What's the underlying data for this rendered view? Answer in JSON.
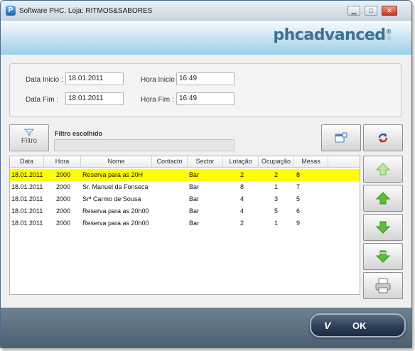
{
  "window": {
    "title": "Software PHC. Loja: RITMOS&SABORES",
    "icon": "phc-app-icon",
    "controls": {
      "minimize": "▁",
      "maximize": "□",
      "close": "✕"
    }
  },
  "header": {
    "logo": "phcadvanced",
    "logo_mark": "®"
  },
  "dates": {
    "data_inicio_label": "Data Inicio :",
    "data_inicio_value": "18.01.2011",
    "hora_inicio_label": "Hora Inicio :",
    "hora_inicio_value": "16:49",
    "data_fim_label": "Data Fim :",
    "data_fim_value": "18.01.2011",
    "hora_fim_label": "Hora Fim :",
    "hora_fim_value": "16:49"
  },
  "filter": {
    "button_label": "Filtro",
    "chosen_label": "Filtro escolhido",
    "chosen_value": ""
  },
  "grid": {
    "columns": [
      "Data",
      "Hora",
      "Nome",
      "Contacto",
      "Sector",
      "Lotação",
      "Ocupação",
      "Mesas"
    ],
    "rows": [
      {
        "data": "18.01.2011",
        "hora": "2000",
        "nome": "Reserva para as 20H",
        "contacto": "",
        "sector": "Bar",
        "lotacao": "2",
        "ocupacao": "2",
        "mesas": "8",
        "selected": true
      },
      {
        "data": "18.01.2011",
        "hora": "2000",
        "nome": "Sr. Manuel da Fonseca",
        "contacto": "",
        "sector": "Bar",
        "lotacao": "8",
        "ocupacao": "1",
        "mesas": "7",
        "selected": false
      },
      {
        "data": "18.01.2011",
        "hora": "2000",
        "nome": "Srª Carmo de Sousa",
        "contacto": "",
        "sector": "Bar",
        "lotacao": "4",
        "ocupacao": "3",
        "mesas": "5",
        "selected": false
      },
      {
        "data": "18.01.2011",
        "hora": "2000",
        "nome": "Reserva para as 20h00",
        "contacto": "",
        "sector": "Bar",
        "lotacao": "4",
        "ocupacao": "5",
        "mesas": "6",
        "selected": false
      },
      {
        "data": "18.01.2011",
        "hora": "2000",
        "nome": "Reserva para as 20h00",
        "contacto": "",
        "sector": "Bar",
        "lotacao": "2",
        "ocupacao": "1",
        "mesas": "9",
        "selected": false
      }
    ]
  },
  "side_buttons": [
    "config-icon",
    "refresh-icon",
    "move-top-icon",
    "move-up-icon",
    "move-down-icon",
    "move-bottom-icon",
    "print-icon"
  ],
  "footer": {
    "ok_label": "OK",
    "ok_check": "V"
  },
  "colors": {
    "selected_row": "#ffff00",
    "accent": "#3f6f94",
    "arrow_green": "#5bbf3a"
  }
}
